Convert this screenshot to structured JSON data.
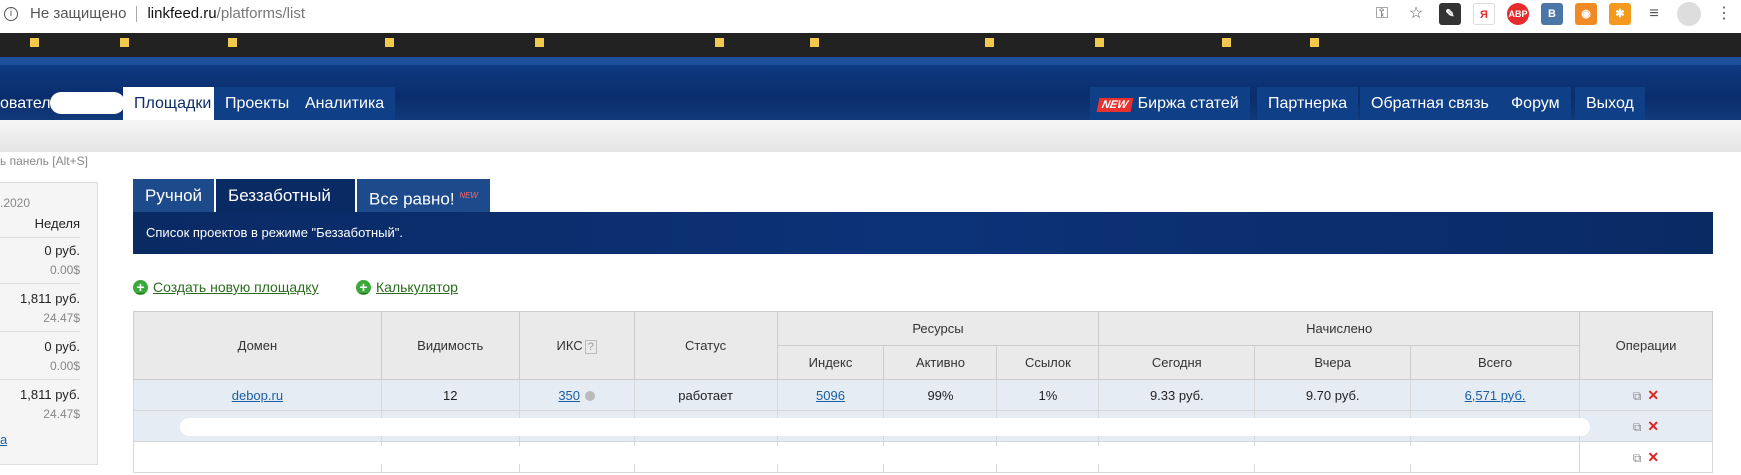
{
  "browser": {
    "insecure_label": "Не защищено",
    "url_host": "linkfeed.ru",
    "url_path": "/platforms/list",
    "extensions": [
      {
        "name": "pen-extension",
        "text": "",
        "color": "#333333"
      },
      {
        "name": "yandex-extension",
        "text": "Я",
        "color": "#ffffff"
      },
      {
        "name": "abp-extension",
        "text": "ABP",
        "color": "#e52b2b"
      },
      {
        "name": "vk-extension",
        "text": "B",
        "color": "#4a76a8"
      },
      {
        "name": "rss-extension",
        "text": "",
        "color": "#f08a24"
      },
      {
        "name": "ok-extension",
        "text": "",
        "color": "#f39a1e"
      }
    ]
  },
  "nav": {
    "user_partial": "ователь",
    "items": [
      "Площадки",
      "Проекты",
      "Аналитика"
    ],
    "right_items": [
      "Биржа статей",
      "Партнерка",
      "Обратная связь",
      "Форум",
      "Выход"
    ],
    "new_badge": "NEW"
  },
  "left": {
    "hint": "ь панель [Alt+S]",
    "date": ".2020",
    "week_label": "Неделя",
    "values": [
      {
        "rub": "0 руб.",
        "usd": "0.00$"
      },
      {
        "rub": "1,811 руб.",
        "usd": "24.47$"
      },
      {
        "rub": "0 руб.",
        "usd": "0.00$"
      },
      {
        "rub": "1,811 руб.",
        "usd": "24.47$"
      }
    ],
    "link": "а"
  },
  "tabs": [
    {
      "label": "Ручной",
      "sup": ""
    },
    {
      "label": "Беззаботный",
      "sup": ""
    },
    {
      "label": "Все равно!",
      "sup": "NEW"
    }
  ],
  "banner": "Список проектов в режиме \"Беззаботный\".",
  "actions": {
    "create": "Создать новую площадку",
    "calculator": "Калькулятор"
  },
  "table": {
    "headers": {
      "domain": "Домен",
      "visibility": "Видимость",
      "iks": "ИКС",
      "iks_help": "?",
      "status": "Статус",
      "resources": "Ресурсы",
      "accrued": "Начислено",
      "operations": "Операции",
      "index": "Индекс",
      "active": "Активно",
      "links": "Ссылок",
      "today": "Сегодня",
      "yesterday": "Вчера",
      "total": "Всего"
    },
    "rows": [
      {
        "domain": "debop.ru",
        "visibility": "12",
        "iks": "350",
        "status": "работает",
        "index": "5096",
        "active": "99%",
        "links": "1%",
        "today": "9.33 руб.",
        "yesterday": "9.70 руб.",
        "total": "6,571 руб."
      },
      {
        "domain": "",
        "visibility": "",
        "iks": "",
        "status": "",
        "index": "",
        "active": "",
        "links": "",
        "today": "",
        "yesterday": "",
        "total": ""
      },
      {
        "domain": "",
        "visibility": "",
        "iks": "",
        "status": "",
        "index": "",
        "active": "",
        "links": "",
        "today": "",
        "yesterday": "",
        "total": ""
      }
    ]
  }
}
